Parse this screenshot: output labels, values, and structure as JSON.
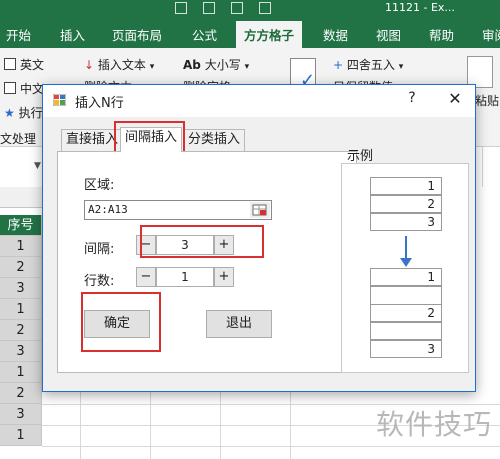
{
  "excel": {
    "title": "11121 - Ex...",
    "ribbon_tabs": [
      "开始",
      "插入",
      "页面布局",
      "公式",
      "方方格子",
      "数据",
      "视图",
      "帮助",
      "审阅"
    ],
    "active_tab_index": 4,
    "ribbon_items": {
      "english": "英文",
      "chinese": "中文",
      "execute": "执行",
      "insert_text": "插入文本",
      "delete_text": "删除文本",
      "case": "大小写",
      "delete_space": "删除空格",
      "round": "四舍五入",
      "keep_number": "只保留数值",
      "paste": "粘贴"
    },
    "group_label": "文处理",
    "column_header": "序号",
    "column_values": [
      "1",
      "2",
      "3",
      "1",
      "2",
      "3",
      "1",
      "2",
      "3",
      "1"
    ]
  },
  "dialog": {
    "title": "插入N行",
    "help": "?",
    "close": "✕",
    "tabs": [
      "直接插入",
      "间隔插入",
      "分类插入"
    ],
    "active_tab_index": 1,
    "range_label": "区域:",
    "range_value": "A2:A13",
    "interval_label": "间隔:",
    "interval_value": "3",
    "rows_label": "行数:",
    "rows_value": "1",
    "minus": "−",
    "plus": "+",
    "ok": "确定",
    "exit": "退出",
    "example_label": "示例",
    "example_top": [
      "1",
      "2",
      "3"
    ],
    "example_bottom": [
      "1",
      "",
      "2",
      "",
      "3"
    ]
  },
  "watermark": "软件技巧",
  "colors": {
    "excel_green": "#217346",
    "highlight_red": "#d9302f",
    "arrow_blue": "#3a74c4"
  }
}
